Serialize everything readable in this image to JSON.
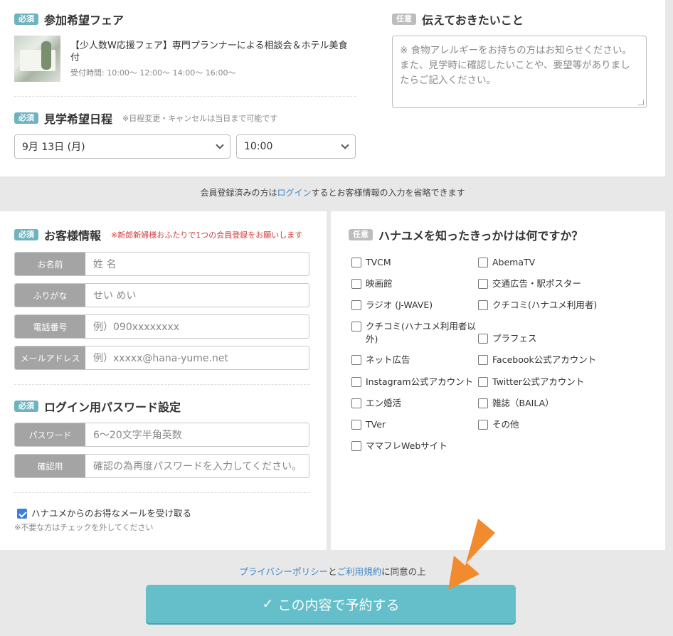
{
  "fair": {
    "required": "必須",
    "title": "参加希望フェア",
    "name": "【少人数W応援フェア】専門プランナーによる相談会＆ホテル美食付",
    "hours": "受付時間: 10:00〜 12:00〜 14:00〜 16:00〜"
  },
  "schedule": {
    "required": "必須",
    "title": "見学希望日程",
    "note": "※日程変更・キャンセルは当日まで可能です",
    "date": "9月 13日 (月)",
    "time": "10:00"
  },
  "message": {
    "optional": "任意",
    "title": "伝えておきたいこと",
    "placeholder": "※ 食物アレルギーをお持ちの方はお知らせください。また、見学時に確認したいことや、要望等がありましたらご記入ください。"
  },
  "login_note": {
    "before": "会員登録済みの方は",
    "link": "ログイン",
    "after": "するとお客様情報の入力を省略できます"
  },
  "customer": {
    "required": "必須",
    "title": "お客様情報",
    "note": "※新郎新婦様おふたりで1つの会員登録をお願いします",
    "fields": [
      {
        "label": "お名前",
        "placeholder": "姓 名"
      },
      {
        "label": "ふりがな",
        "placeholder": "せい めい"
      },
      {
        "label": "電話番号",
        "placeholder": "例）090xxxxxxxx"
      },
      {
        "label": "メールアドレス",
        "placeholder": "例）xxxxx@hana-yume.net"
      }
    ]
  },
  "password": {
    "required": "必須",
    "title": "ログイン用パスワード設定",
    "fields": [
      {
        "label": "パスワード",
        "placeholder": "6〜20文字半角英数"
      },
      {
        "label": "確認用",
        "placeholder": "確認の為再度パスワードを入力してください。"
      }
    ]
  },
  "newsletter": {
    "label": "ハナユメからのお得なメールを受け取る",
    "checked": true,
    "note": "※不要な方はチェックを外してください"
  },
  "source": {
    "optional": "任意",
    "title": "ハナユメを知ったきっかけは何ですか？",
    "options": [
      "TVCM",
      "AbemaTV",
      "映画館",
      "交通広告・駅ポスター",
      "ラジオ (J-WAVE)",
      "クチコミ(ハナユメ利用者)",
      "クチコミ(ハナユメ利用者以外)",
      "プラフェス",
      "ネット広告",
      "Facebook公式アカウント",
      "Instagram公式アカウント",
      "Twitter公式アカウント",
      "エン婚活",
      "雑誌（BAILA）",
      "TVer",
      "その他",
      "ママフレWebサイト"
    ]
  },
  "agree": {
    "privacy": "プライバシーポリシー",
    "and": "と",
    "terms": "ご利用規約",
    "after": "に同意の上"
  },
  "submit": {
    "check": "✓",
    "label": "この内容で予約する"
  },
  "colors": {
    "accent": "#64bfcb",
    "required_badge": "#6fb3c0",
    "link": "#3a86c8",
    "arrow": "#f28a2e"
  }
}
